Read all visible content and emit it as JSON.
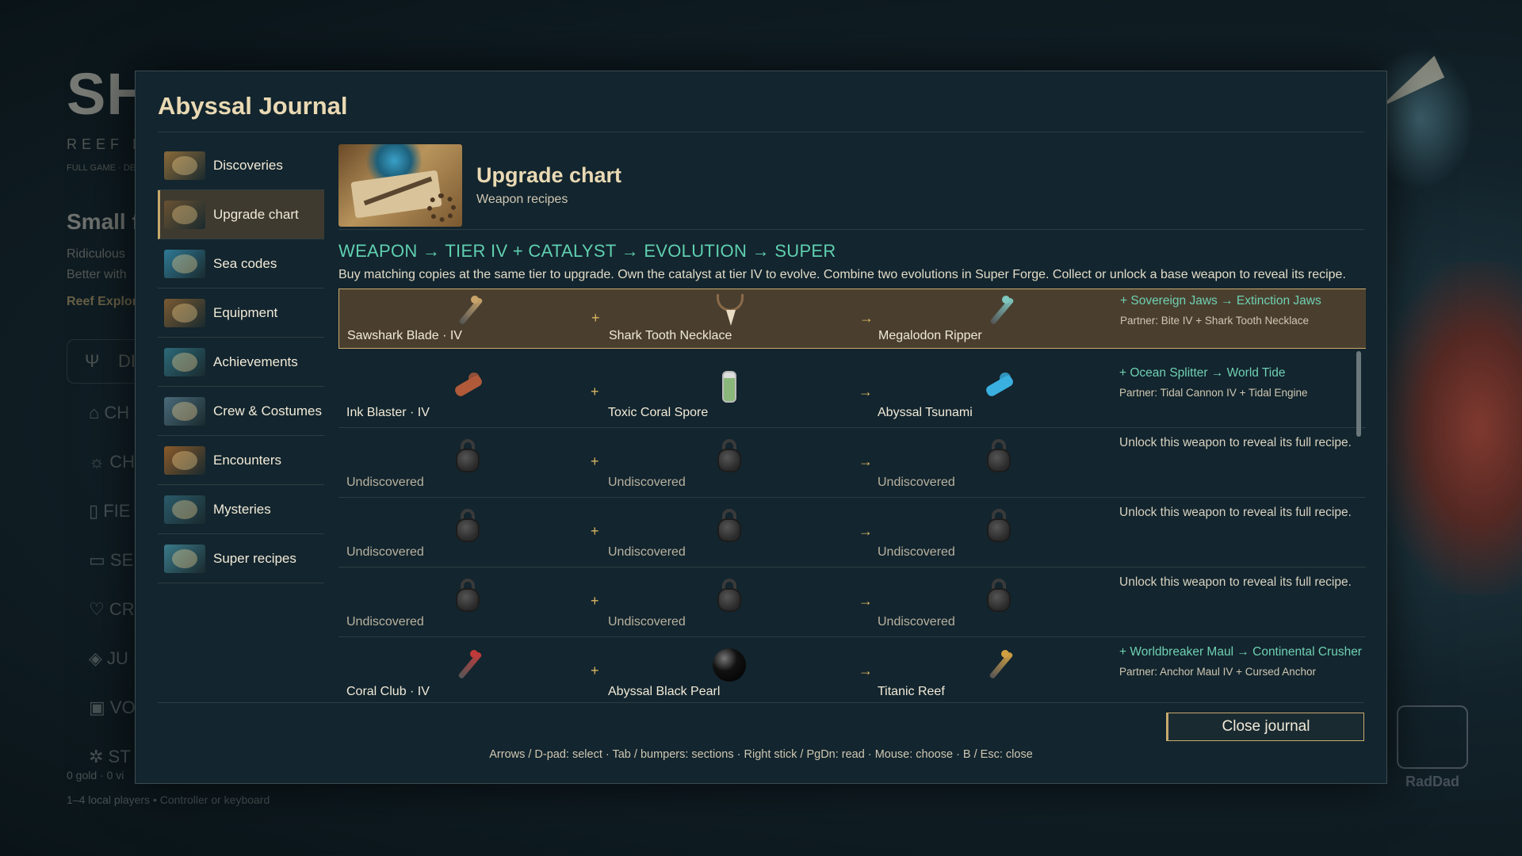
{
  "background": {
    "title": "SHARK TALES",
    "subtitle": "REEF RO",
    "edition": "FULL GAME · DE",
    "heading": "Small fi",
    "lines": [
      "Ridiculous",
      "Better with"
    ],
    "link": "Reef Explore",
    "menu_item_1": "DI",
    "menu_items": [
      "CH",
      "CH",
      "FIE",
      "SE",
      "CR",
      "JU",
      "VO",
      "ST"
    ],
    "footer_stats": "0 gold  ·  0 vi",
    "footer_players": "1–4 local players  •  Controller or keyboard",
    "logo_text": "RadDad"
  },
  "journal": {
    "title": "Abyssal Journal",
    "nav": [
      {
        "label": "Discoveries",
        "thumb": "#8a6a3a",
        "icon": "discoveries-thumb-icon"
      },
      {
        "label": "Upgrade chart",
        "thumb": "#6a5232",
        "icon": "upgrade-chart-thumb-icon",
        "active": true
      },
      {
        "label": "Sea codes",
        "thumb": "#2f7a96",
        "icon": "sea-codes-thumb-icon"
      },
      {
        "label": "Equipment",
        "thumb": "#7a5a32",
        "icon": "equipment-thumb-icon"
      },
      {
        "label": "Achievements",
        "thumb": "#2c6a7a",
        "icon": "achievements-thumb-icon"
      },
      {
        "label": "Crew & Costumes",
        "thumb": "#4a6a7a",
        "icon": "crew-costumes-thumb-icon"
      },
      {
        "label": "Encounters",
        "thumb": "#8a5a2a",
        "icon": "encounters-thumb-icon"
      },
      {
        "label": "Mysteries",
        "thumb": "#2a5a6a",
        "icon": "mysteries-thumb-icon"
      },
      {
        "label": "Super recipes",
        "thumb": "#3a7a8a",
        "icon": "super-recipes-thumb-icon"
      }
    ],
    "section": {
      "title": "Upgrade chart",
      "subtitle": "Weapon recipes",
      "formula": "WEAPON → TIER IV + CATALYST → EVOLUTION → SUPER",
      "description": "Buy matching copies at the same tier to upgrade. Own the catalyst at tier IV to evolve. Combine two evolutions in Super Forge. Collect or unlock a base weapon to reveal its recipe."
    },
    "operators": {
      "plus": "+",
      "arrow": "→"
    },
    "recipes": [
      {
        "weapon": "Sawshark Blade · IV",
        "catalyst": "Shark Tooth Necklace",
        "evolution": "Megalodon Ripper",
        "super_line": "+ Sovereign Jaws → Extinction Jaws",
        "partner": "Partner: Bite IV + Shark Tooth Necklace",
        "discovered": true,
        "active": true,
        "icons": [
          "sawshark-blade-icon",
          "shark-tooth-necklace-icon",
          "megalodon-ripper-icon"
        ],
        "colors": [
          "#c9a46a",
          "#b8a080",
          "#7ec8c0"
        ]
      },
      {
        "weapon": "Ink Blaster · IV",
        "catalyst": "Toxic Coral Spore",
        "evolution": "Abyssal Tsunami",
        "super_line": "+ Ocean Splitter → World Tide",
        "partner": "Partner: Tidal Cannon IV + Tidal Engine",
        "discovered": true,
        "icons": [
          "ink-blaster-icon",
          "toxic-coral-spore-icon",
          "abyssal-tsunami-icon"
        ],
        "colors": [
          "#b05a3a",
          "#8ab87a",
          "#3ab0e0"
        ]
      },
      {
        "weapon": "Undiscovered",
        "catalyst": "Undiscovered",
        "evolution": "Undiscovered",
        "lock_text": "Unlock this weapon to reveal its full recipe.",
        "discovered": false
      },
      {
        "weapon": "Undiscovered",
        "catalyst": "Undiscovered",
        "evolution": "Undiscovered",
        "lock_text": "Unlock this weapon to reveal its full recipe.",
        "discovered": false
      },
      {
        "weapon": "Undiscovered",
        "catalyst": "Undiscovered",
        "evolution": "Undiscovered",
        "lock_text": "Unlock this weapon to reveal its full recipe.",
        "discovered": false
      },
      {
        "weapon": "Coral Club · IV",
        "catalyst": "Abyssal Black Pearl",
        "evolution": "Titanic Reef",
        "super_line": "+ Worldbreaker Maul → Continental Crusher",
        "partner": "Partner: Anchor Maul IV + Cursed Anchor",
        "discovered": true,
        "icons": [
          "coral-club-icon",
          "abyssal-black-pearl-icon",
          "titanic-reef-icon"
        ],
        "colors": [
          "#c03a3a",
          "#111111",
          "#d0a040"
        ]
      }
    ],
    "close_label": "Close journal",
    "hint": "Arrows / D-pad: select · Tab / bumpers: sections · Right stick / PgDn: read · Mouse: choose · B / Esc: close"
  }
}
